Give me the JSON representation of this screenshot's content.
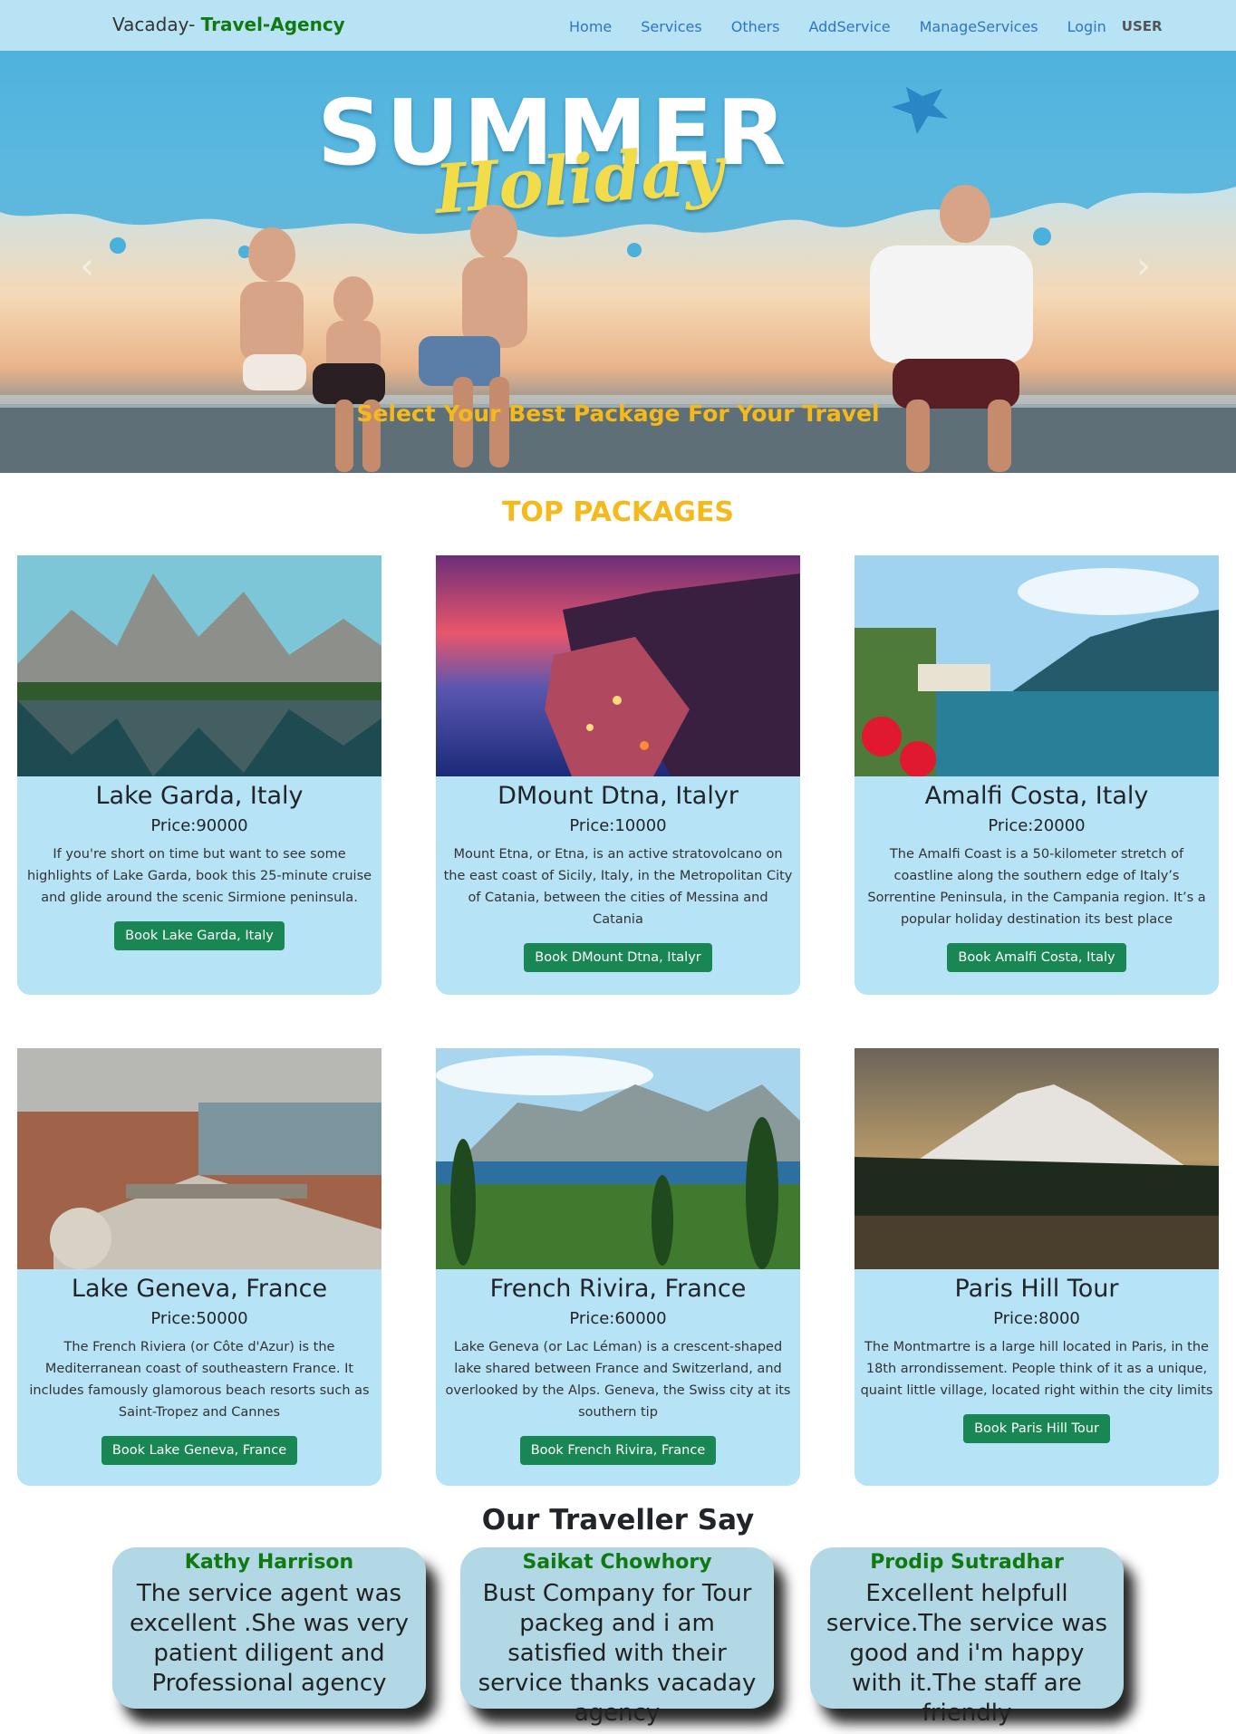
{
  "nav": {
    "brand_prefix": "Vacaday-",
    "brand_accent": "Travel-Agency",
    "links": [
      "Home",
      "Services",
      "Others",
      "AddService",
      "ManageServices",
      "Login"
    ],
    "user_label": "USER"
  },
  "hero": {
    "title_line1": "SUMMER",
    "title_line2": "Holiday",
    "caption": "Select Your Best Package For Your Travel",
    "prev_icon": "chevron-left-icon",
    "next_icon": "chevron-right-icon"
  },
  "packages": {
    "title": "TOP PACKAGES",
    "items": [
      {
        "name": "Lake Garda, Italy",
        "price": "Price:90000",
        "desc": "If you're short on time but want to see some highlights of Lake Garda, book this 25-minute cruise and glide around the scenic Sirmione peninsula.",
        "button": "Book Lake Garda, Italy"
      },
      {
        "name": "DMount Dtna, Italyr",
        "price": "Price:10000",
        "desc": "Mount Etna, or Etna, is an active stratovolcano on the east coast of Sicily, Italy, in the Metropolitan City of Catania, between the cities of Messina and Catania",
        "button": "Book DMount Dtna, Italyr"
      },
      {
        "name": "Amalfi Costa, Italy",
        "price": "Price:20000",
        "desc": "The Amalfi Coast is a 50-kilometer stretch of coastline along the southern edge of Italy’s Sorrentine Peninsula, in the Campania region. It’s a popular holiday destination its best place",
        "button": "Book Amalfi Costa, Italy"
      },
      {
        "name": "Lake Geneva, France",
        "price": "Price:50000",
        "desc": "The French Riviera (or Côte d'Azur) is the Mediterranean coast of southeastern France. It includes famously glamorous beach resorts such as Saint-Tropez and Cannes",
        "button": "Book Lake Geneva, France"
      },
      {
        "name": "French Rivira, France",
        "price": "Price:60000",
        "desc": "Lake Geneva (or Lac Léman) is a crescent-shaped lake shared between France and Switzerland, and overlooked by the Alps. Geneva, the Swiss city at its southern tip",
        "button": "Book French Rivira, France"
      },
      {
        "name": "Paris Hill Tour",
        "price": "Price:8000",
        "desc": "The Montmartre is a large hill located in Paris, in the 18th arrondissement. People think of it as a unique, quaint little village, located right within the city limits",
        "button": "Book Paris Hill Tour"
      }
    ]
  },
  "testimonials": {
    "title": "Our Traveller Say",
    "items": [
      {
        "name": "Kathy Harrison",
        "text": "The service agent was excellent .She was very patient diligent and Professional agency"
      },
      {
        "name": "Saikat Chowhory",
        "text": "Bust Company for Tour packeg and i am satisfied with their service thanks vacaday agency"
      },
      {
        "name": "Prodip Sutradhar",
        "text": "Excellent helpfull service.The service was good and i'm happy with it.The staff are friendly"
      }
    ]
  },
  "colors": {
    "navbar_bg": "#b8e3f5",
    "nav_link": "#2f74c8",
    "brand_accent": "#107a10",
    "section_title": "#f6b91c",
    "card_bg": "#b6e3f6",
    "button_bg": "#198754",
    "testimonial_bg": "#b2d8e6",
    "testimonial_name": "#107a10"
  }
}
